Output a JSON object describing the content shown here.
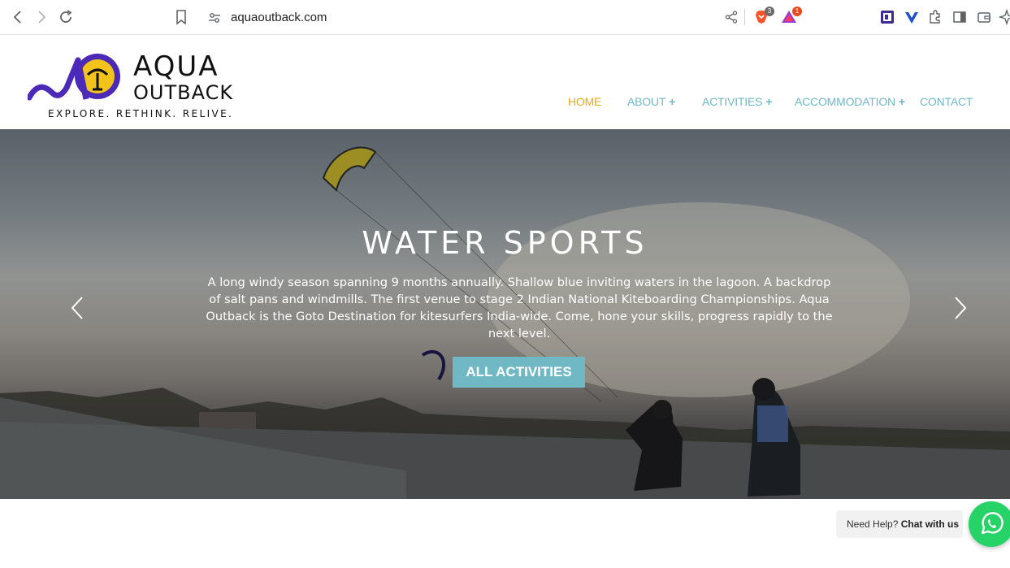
{
  "browser": {
    "url": "aquaoutback.com",
    "brave_badge": "3",
    "rewards_badge": "1"
  },
  "site": {
    "logo": {
      "word1": "AQUA",
      "word2": "OUTBACK",
      "tagline": "EXPLORE.   RETHINK.   RELIVE."
    },
    "nav": [
      {
        "label": "HOME",
        "active": true
      },
      {
        "label": "ABOUT",
        "plus": "+"
      },
      {
        "label": "ACTIVITIES",
        "plus": "+"
      },
      {
        "label": "ACCOMMODATION",
        "plus": "+"
      },
      {
        "label": "CONTACT"
      }
    ]
  },
  "hero": {
    "title": "WATER SPORTS",
    "text": "A long windy season spanning 9 months annually. Shallow blue inviting waters in the lagoon. A backdrop of salt pans and windmills. The first venue to stage 2 Indian National Kiteboarding Championships. Aqua Outback is the Goto Destination for kitesurfers India-wide. Come, hone your skills, progress rapidly to the next level.",
    "button": "ALL ACTIVITIES"
  },
  "chat": {
    "prefix": "Need Help?",
    "strong": "Chat with us"
  },
  "colors": {
    "accent": "#6fb8c4",
    "active_nav": "#e8a925",
    "whatsapp": "#25d366"
  }
}
